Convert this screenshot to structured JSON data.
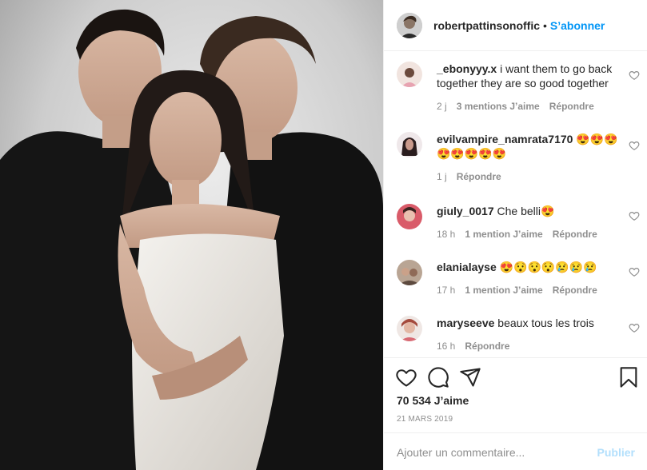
{
  "header": {
    "username": "robertpattinsonoffic",
    "separator": "•",
    "follow_label": "S’abonner"
  },
  "comments": [
    {
      "username": "_ebonyyy.x",
      "text": "i want them to go back together they are so good together",
      "time": "2 j",
      "likes": "3 mentions J’aime",
      "reply": "Répondre"
    },
    {
      "username": "evilvampire_namrata7170",
      "text": "😍😍😍😍😍😍😍😍",
      "time": "1 j",
      "likes": "",
      "reply": "Répondre"
    },
    {
      "username": "giuly_0017",
      "text": "Che belli😍",
      "time": "18 h",
      "likes": "1 mention J’aime",
      "reply": "Répondre"
    },
    {
      "username": "elanialayse",
      "text": "😍😯😯😯😢😢😢",
      "time": "17 h",
      "likes": "1 mention J’aime",
      "reply": "Répondre"
    },
    {
      "username": "maryseeve",
      "text": "beaux tous les trois",
      "time": "16 h",
      "likes": "",
      "reply": "Répondre"
    }
  ],
  "post": {
    "likes": "70 534 J’aime",
    "date": "21 MARS 2019"
  },
  "comment_box": {
    "placeholder": "Ajouter un commentaire...",
    "publish_label": "Publier"
  },
  "icons": {
    "like": "heart-icon",
    "comment": "comment-icon",
    "share": "share-icon",
    "save": "bookmark-icon"
  },
  "colors": {
    "link_blue": "#0095f6",
    "publish_disabled": "#b2dffc",
    "meta_gray": "#8e8e8e",
    "text": "#262626"
  }
}
